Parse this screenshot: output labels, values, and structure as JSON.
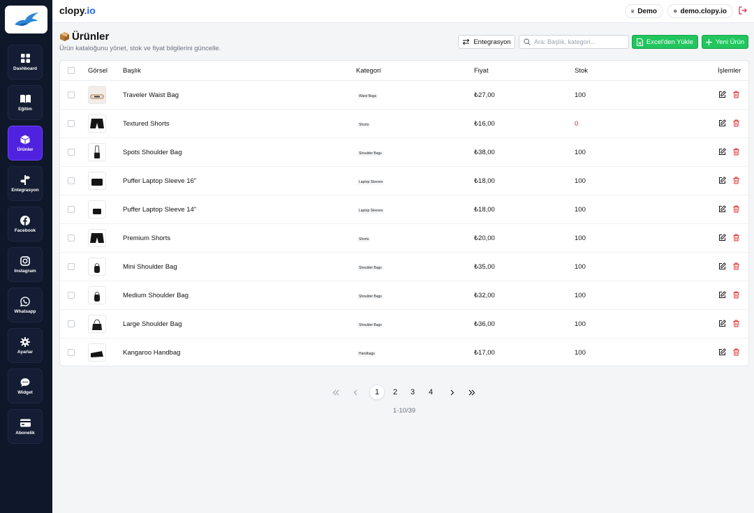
{
  "app": {
    "brand_main": "clopy",
    "brand_tld": ".io",
    "account_label": "Demo",
    "domain_label": "demo.clopy.io"
  },
  "sidebar": {
    "items": [
      {
        "label": "Dashboard",
        "icon": "dashboard-icon"
      },
      {
        "label": "Eğitim",
        "icon": "book-icon"
      },
      {
        "label": "Ürünler",
        "icon": "box-icon",
        "active": true
      },
      {
        "label": "Entegrasyon",
        "icon": "signpost-icon"
      },
      {
        "label": "Facebook",
        "icon": "facebook-icon"
      },
      {
        "label": "Instagram",
        "icon": "instagram-icon"
      },
      {
        "label": "Whatsapp",
        "icon": "whatsapp-icon"
      },
      {
        "label": "Ayarlar",
        "icon": "gear-icon"
      },
      {
        "label": "Widget",
        "icon": "chat-icon"
      },
      {
        "label": "Abonelik",
        "icon": "credit-card-icon"
      }
    ]
  },
  "header": {
    "title": "Ürünler",
    "subtitle": "Ürün kataloğunu yönet, stok ve fiyat bilgilerini güncelle.",
    "integration_button": "Entegrasyon",
    "search_placeholder": "Ara: Başlık, kategori...",
    "excel_button": "Excel'den Yükle",
    "new_button": "Yeni Ürün"
  },
  "table": {
    "columns": {
      "image": "Görsel",
      "title": "Başlık",
      "category": "Kategori",
      "price": "Fiyat",
      "stock": "Stok",
      "actions": "İşlemler"
    },
    "rows": [
      {
        "title": "Traveler Waist Bag",
        "category": "Waist Bags",
        "price": "₺27,00",
        "stock": "100",
        "thumb": "waist-bag"
      },
      {
        "title": "Textured Shorts",
        "category": "Shorts",
        "price": "₺16,00",
        "stock": "0",
        "thumb": "shorts"
      },
      {
        "title": "Spots Shoulder Bag",
        "category": "Shoulder Bags",
        "price": "₺38,00",
        "stock": "100",
        "thumb": "shoulder-bag"
      },
      {
        "title": "Puffer Laptop Sleeve 16\"",
        "category": "Laptop Sleeves",
        "price": "₺18,00",
        "stock": "100",
        "thumb": "sleeve"
      },
      {
        "title": "Puffer Laptop Sleeve 14\"",
        "category": "Laptop Sleeves",
        "price": "₺18,00",
        "stock": "100",
        "thumb": "sleeve-small"
      },
      {
        "title": "Premium Shorts",
        "category": "Shorts",
        "price": "₺20,00",
        "stock": "100",
        "thumb": "shorts"
      },
      {
        "title": "Mini Shoulder Bag",
        "category": "Shoulder Bags",
        "price": "₺35,00",
        "stock": "100",
        "thumb": "mini-bag"
      },
      {
        "title": "Medium Shoulder Bag",
        "category": "Shoulder Bags",
        "price": "₺32,00",
        "stock": "100",
        "thumb": "mini-bag"
      },
      {
        "title": "Large Shoulder Bag",
        "category": "Shoulder Bags",
        "price": "₺36,00",
        "stock": "100",
        "thumb": "large-bag"
      },
      {
        "title": "Kangaroo Handbag",
        "category": "Handbags",
        "price": "₺17,00",
        "stock": "100",
        "thumb": "handbag"
      }
    ]
  },
  "pagination": {
    "pages": [
      "1",
      "2",
      "3",
      "4"
    ],
    "current": "1",
    "range_label": "1-10/39"
  },
  "colors": {
    "sidebar_bg": "#0f172a",
    "active_nav": "#4f22e0",
    "primary_green": "#22c55e",
    "danger": "#dc2626",
    "brand_blue": "#2563eb"
  }
}
